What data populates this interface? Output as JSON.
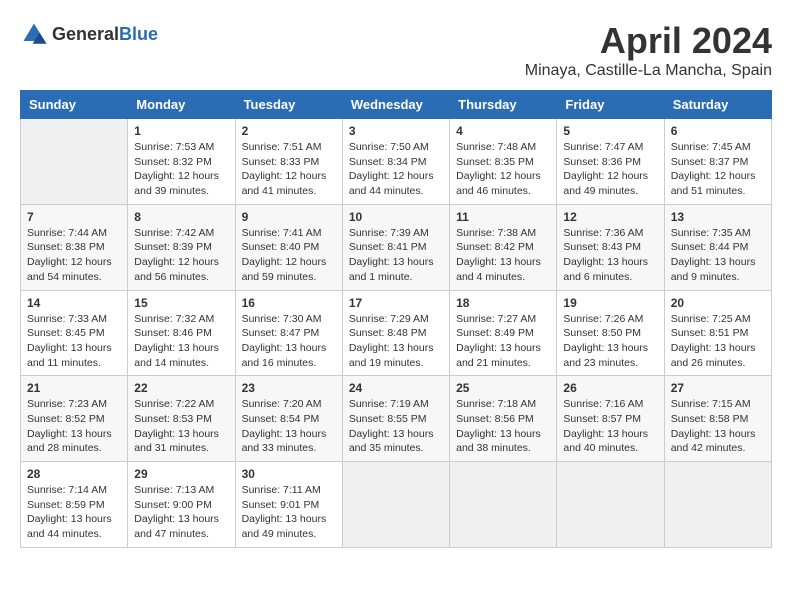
{
  "header": {
    "logo_general": "General",
    "logo_blue": "Blue",
    "month_title": "April 2024",
    "location": "Minaya, Castille-La Mancha, Spain"
  },
  "weekdays": [
    "Sunday",
    "Monday",
    "Tuesday",
    "Wednesday",
    "Thursday",
    "Friday",
    "Saturday"
  ],
  "weeks": [
    [
      {
        "day": "",
        "content": ""
      },
      {
        "day": "1",
        "content": "Sunrise: 7:53 AM\nSunset: 8:32 PM\nDaylight: 12 hours\nand 39 minutes."
      },
      {
        "day": "2",
        "content": "Sunrise: 7:51 AM\nSunset: 8:33 PM\nDaylight: 12 hours\nand 41 minutes."
      },
      {
        "day": "3",
        "content": "Sunrise: 7:50 AM\nSunset: 8:34 PM\nDaylight: 12 hours\nand 44 minutes."
      },
      {
        "day": "4",
        "content": "Sunrise: 7:48 AM\nSunset: 8:35 PM\nDaylight: 12 hours\nand 46 minutes."
      },
      {
        "day": "5",
        "content": "Sunrise: 7:47 AM\nSunset: 8:36 PM\nDaylight: 12 hours\nand 49 minutes."
      },
      {
        "day": "6",
        "content": "Sunrise: 7:45 AM\nSunset: 8:37 PM\nDaylight: 12 hours\nand 51 minutes."
      }
    ],
    [
      {
        "day": "7",
        "content": "Sunrise: 7:44 AM\nSunset: 8:38 PM\nDaylight: 12 hours\nand 54 minutes."
      },
      {
        "day": "8",
        "content": "Sunrise: 7:42 AM\nSunset: 8:39 PM\nDaylight: 12 hours\nand 56 minutes."
      },
      {
        "day": "9",
        "content": "Sunrise: 7:41 AM\nSunset: 8:40 PM\nDaylight: 12 hours\nand 59 minutes."
      },
      {
        "day": "10",
        "content": "Sunrise: 7:39 AM\nSunset: 8:41 PM\nDaylight: 13 hours\nand 1 minute."
      },
      {
        "day": "11",
        "content": "Sunrise: 7:38 AM\nSunset: 8:42 PM\nDaylight: 13 hours\nand 4 minutes."
      },
      {
        "day": "12",
        "content": "Sunrise: 7:36 AM\nSunset: 8:43 PM\nDaylight: 13 hours\nand 6 minutes."
      },
      {
        "day": "13",
        "content": "Sunrise: 7:35 AM\nSunset: 8:44 PM\nDaylight: 13 hours\nand 9 minutes."
      }
    ],
    [
      {
        "day": "14",
        "content": "Sunrise: 7:33 AM\nSunset: 8:45 PM\nDaylight: 13 hours\nand 11 minutes."
      },
      {
        "day": "15",
        "content": "Sunrise: 7:32 AM\nSunset: 8:46 PM\nDaylight: 13 hours\nand 14 minutes."
      },
      {
        "day": "16",
        "content": "Sunrise: 7:30 AM\nSunset: 8:47 PM\nDaylight: 13 hours\nand 16 minutes."
      },
      {
        "day": "17",
        "content": "Sunrise: 7:29 AM\nSunset: 8:48 PM\nDaylight: 13 hours\nand 19 minutes."
      },
      {
        "day": "18",
        "content": "Sunrise: 7:27 AM\nSunset: 8:49 PM\nDaylight: 13 hours\nand 21 minutes."
      },
      {
        "day": "19",
        "content": "Sunrise: 7:26 AM\nSunset: 8:50 PM\nDaylight: 13 hours\nand 23 minutes."
      },
      {
        "day": "20",
        "content": "Sunrise: 7:25 AM\nSunset: 8:51 PM\nDaylight: 13 hours\nand 26 minutes."
      }
    ],
    [
      {
        "day": "21",
        "content": "Sunrise: 7:23 AM\nSunset: 8:52 PM\nDaylight: 13 hours\nand 28 minutes."
      },
      {
        "day": "22",
        "content": "Sunrise: 7:22 AM\nSunset: 8:53 PM\nDaylight: 13 hours\nand 31 minutes."
      },
      {
        "day": "23",
        "content": "Sunrise: 7:20 AM\nSunset: 8:54 PM\nDaylight: 13 hours\nand 33 minutes."
      },
      {
        "day": "24",
        "content": "Sunrise: 7:19 AM\nSunset: 8:55 PM\nDaylight: 13 hours\nand 35 minutes."
      },
      {
        "day": "25",
        "content": "Sunrise: 7:18 AM\nSunset: 8:56 PM\nDaylight: 13 hours\nand 38 minutes."
      },
      {
        "day": "26",
        "content": "Sunrise: 7:16 AM\nSunset: 8:57 PM\nDaylight: 13 hours\nand 40 minutes."
      },
      {
        "day": "27",
        "content": "Sunrise: 7:15 AM\nSunset: 8:58 PM\nDaylight: 13 hours\nand 42 minutes."
      }
    ],
    [
      {
        "day": "28",
        "content": "Sunrise: 7:14 AM\nSunset: 8:59 PM\nDaylight: 13 hours\nand 44 minutes."
      },
      {
        "day": "29",
        "content": "Sunrise: 7:13 AM\nSunset: 9:00 PM\nDaylight: 13 hours\nand 47 minutes."
      },
      {
        "day": "30",
        "content": "Sunrise: 7:11 AM\nSunset: 9:01 PM\nDaylight: 13 hours\nand 49 minutes."
      },
      {
        "day": "",
        "content": ""
      },
      {
        "day": "",
        "content": ""
      },
      {
        "day": "",
        "content": ""
      },
      {
        "day": "",
        "content": ""
      }
    ]
  ]
}
